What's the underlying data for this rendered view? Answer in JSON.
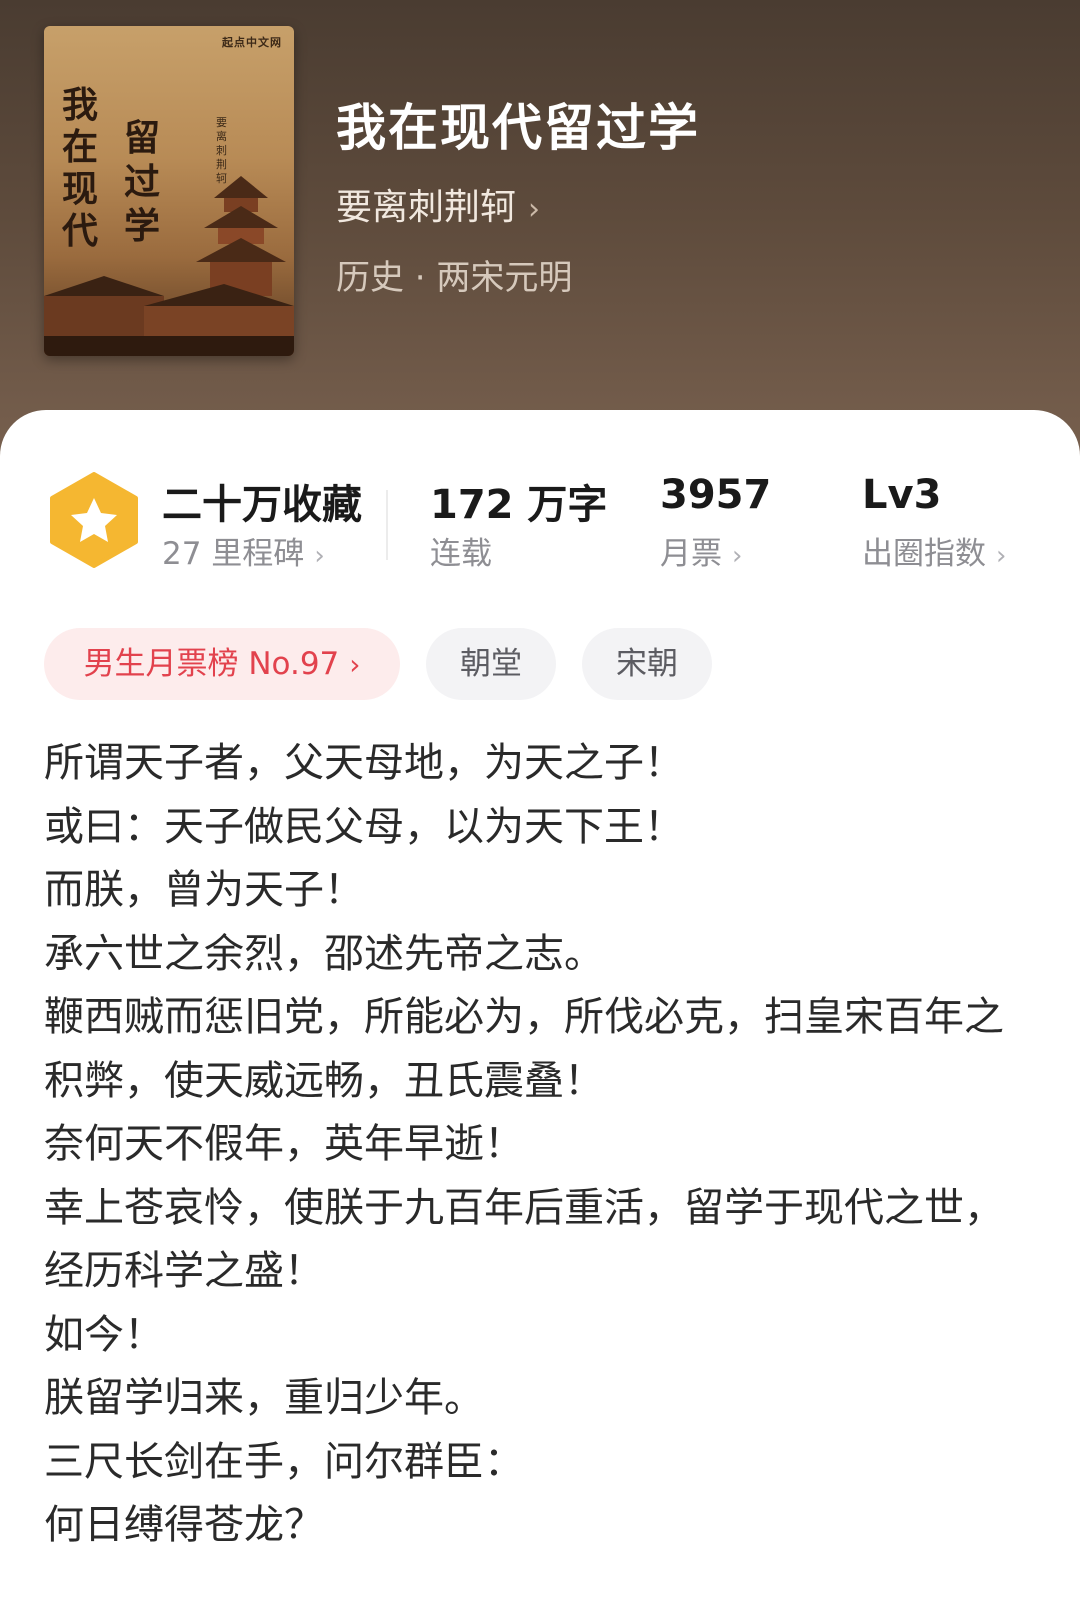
{
  "book": {
    "title": "我在现代留过学",
    "author": "要离刺荆轲",
    "genre": "历史 · 两宋元明",
    "cover": {
      "publisher": "起点中文网",
      "title_col1": "我在现代",
      "title_col2": "留过学",
      "author": "要离刺荆轲"
    }
  },
  "stats": {
    "favorites": {
      "main": "二十万收藏",
      "sub": "27 里程碑"
    },
    "words": {
      "main": "172 万字",
      "sub": "连载"
    },
    "monthly_votes": {
      "main": "3957",
      "sub": "月票"
    },
    "level": {
      "main": "Lv3",
      "sub": "出圈指数"
    },
    "badge_icon": "star-icon"
  },
  "tags": [
    {
      "label": "男生月票榜 No.97"
    },
    {
      "label": "朝堂"
    },
    {
      "label": "宋朝"
    }
  ],
  "synopsis": [
    "所谓天子者，父天母地，为天之子！",
    "或曰：天子做民父母，以为天下王！",
    "而朕，曾为天子！",
    "承六世之余烈，邵述先帝之志。",
    "鞭西贼而惩旧党，所能必为，所伐必克，扫皇宋百年之积弊，使天威远畅，丑氏震叠！",
    "奈何天不假年，英年早逝！",
    "幸上苍哀怜，使朕于九百年后重活，留学于现代之世，经历科学之盛！",
    "如今！",
    "朕留学归来，重归少年。",
    "三尺长剑在手，问尔群臣：",
    "何日缚得苍龙？"
  ],
  "colors": {
    "header_bg": "#5e4b3c",
    "badge": "#f5b731",
    "rank_tag_text": "#e2424d",
    "rank_tag_bg": "#fdecec"
  }
}
